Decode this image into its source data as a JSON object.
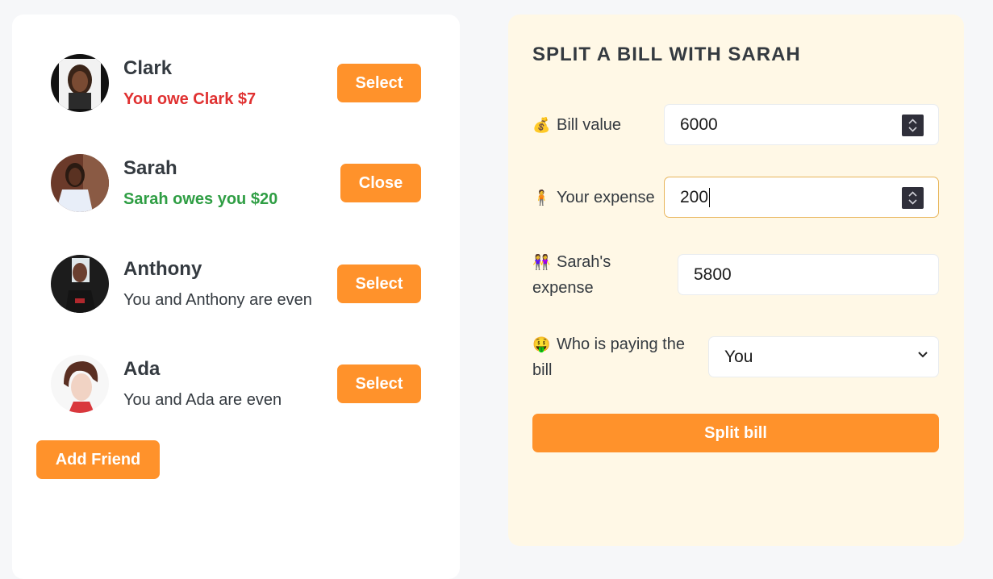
{
  "friends": [
    {
      "name": "Clark",
      "status": "You owe Clark $7",
      "status_type": "owe",
      "button": "Select"
    },
    {
      "name": "Sarah",
      "status": "Sarah owes you $20",
      "status_type": "owed",
      "button": "Close"
    },
    {
      "name": "Anthony",
      "status": "You and Anthony are even",
      "status_type": "even",
      "button": "Select"
    },
    {
      "name": "Ada",
      "status": "You and Ada are even",
      "status_type": "even",
      "button": "Select"
    }
  ],
  "add_friend_label": "Add Friend",
  "form": {
    "title": "SPLIT A BILL WITH SARAH",
    "bill_value": {
      "emoji": "💰",
      "label": "Bill value",
      "value": "6000"
    },
    "your_expense": {
      "emoji": "🧍",
      "label": "Your expense",
      "value": "200"
    },
    "friend_expense": {
      "emoji": "👭",
      "label": "Sarah's expense",
      "value": "5800"
    },
    "who_pays": {
      "emoji": "🤑",
      "label": "Who is paying the bill",
      "value": "You"
    },
    "submit_label": "Split bill"
  },
  "colors": {
    "accent": "#ff922b",
    "owe": "#e03131",
    "owed": "#2f9e44",
    "form_bg": "#fff8e6"
  }
}
